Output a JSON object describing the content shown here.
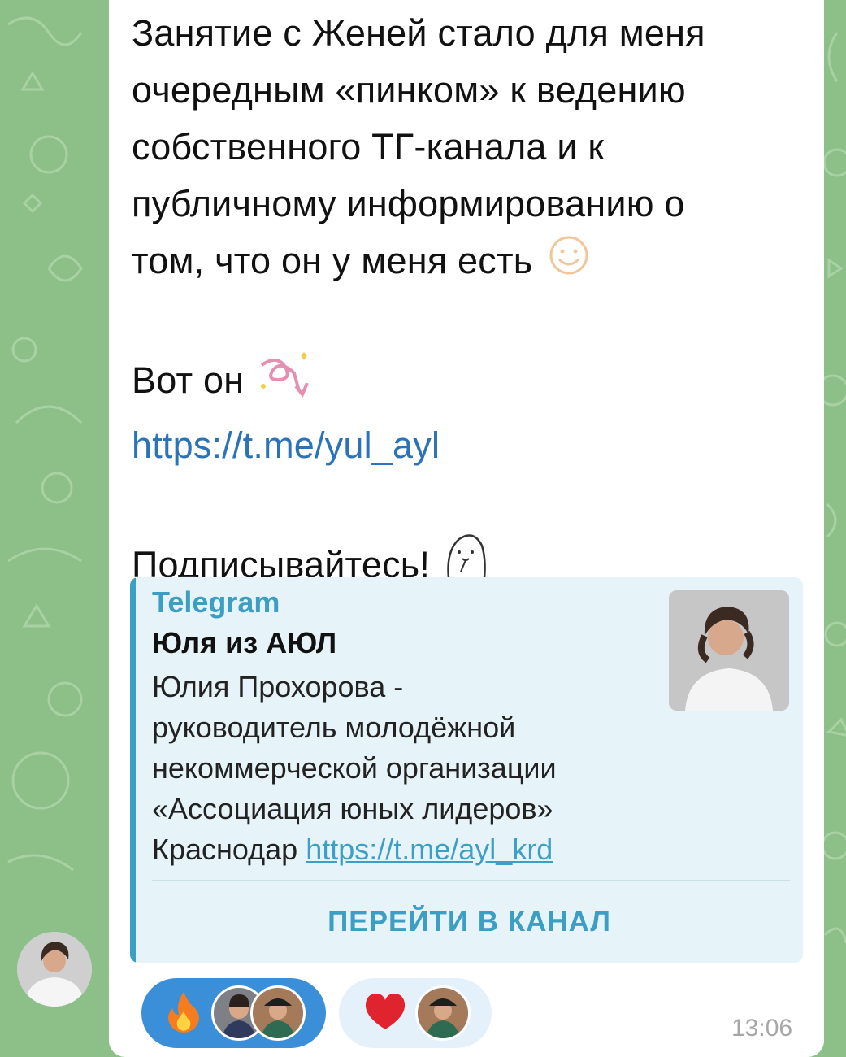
{
  "message": {
    "lines": [
      "Занятие с Женей стало для меня",
      "очередным «пинком» к ведению",
      "собственного ТГ-канала и к",
      "публичному информированию о",
      "том, что он у меня есть"
    ],
    "here_it_is": "Вот он",
    "link": "https://t.me/yul_ayl",
    "subscribe": "Подписывайтесь!",
    "emoji_smile": "smile-emoji",
    "emoji_arrow": "curly-arrow-emoji",
    "emoji_seal": "seal-sticker-emoji"
  },
  "preview": {
    "site": "Telegram",
    "title": "Юля из АЮЛ",
    "desc_lines": [
      "Юлия Прохорова -",
      "руководитель молодёжной",
      "некоммерческой организации",
      "«Ассоциация юных лидеров»"
    ],
    "desc_last_prefix": "Краснодар",
    "desc_link": "https://t.me/ayl_krd",
    "button": "ПЕРЕЙТИ В КАНАЛ"
  },
  "reactions": [
    {
      "icon": "fire-icon",
      "color": "#3b8ed8"
    },
    {
      "icon": "heart-icon",
      "color": "#e5f1fa"
    }
  ],
  "time": "13:06",
  "colors": {
    "wallpaper": "#8dbf88",
    "accent": "#3b9ec2",
    "link": "#2b73b9"
  }
}
